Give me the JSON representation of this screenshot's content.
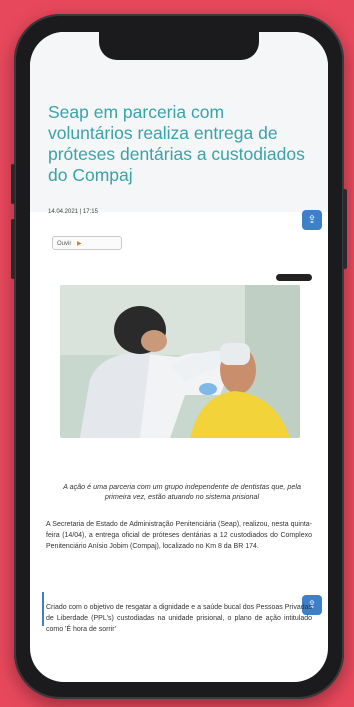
{
  "article": {
    "title": "Seap em parceria com voluntários realiza entrega de próteses dentárias a custodiados do Compaj",
    "meta": "14.04.2021 | 17:15",
    "audio_label": "Ouvir",
    "audio_play": "▶",
    "share_icon": "share-icon",
    "caption": "A ação é uma parceria com um grupo independente de dentistas que, pela primeira vez, estão atuando no sistema prisional",
    "paragraph_1": "A Secretaria de Estado de Administração Penitenciária (Seap), realizou, nesta quinta-feira (14/04), a entrega oficial de próteses dentárias a 12 custodiados do Complexo Penitenciário Anísio Jobim (Compaj), localizado no Km 8 da BR 174.",
    "paragraph_2": "Criado com o objetivo de resgatar a dignidade e a saúde bucal dos Pessoas Privadas de Liberdade (PPL's) custodiadas na unidade prisional, o plano de ação intitulado como 'É hora de sorrir'"
  },
  "colors": {
    "background": "#e8485c",
    "title": "#3aa3a8",
    "share_badge": "#3d7fc9"
  }
}
